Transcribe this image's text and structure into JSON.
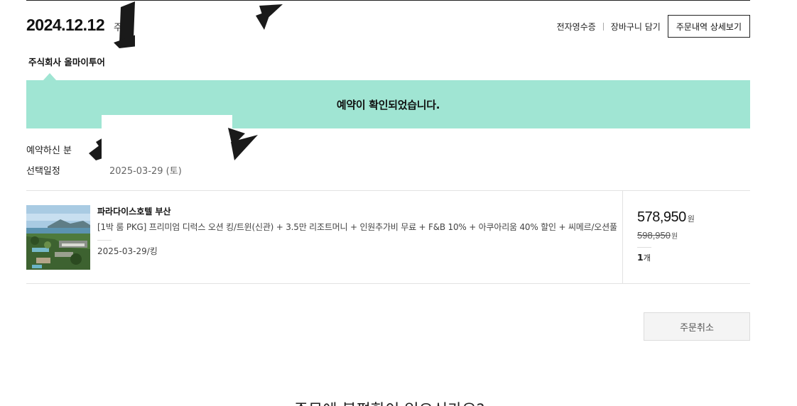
{
  "order": {
    "date": "2024.12.12",
    "number_label": "주"
  },
  "header_actions": {
    "receipt": "전자영수증",
    "cart": "장바구니 담기",
    "detail": "주문내역 상세보기"
  },
  "seller": "주식회사 올마이투어",
  "banner": {
    "message": "예약이 확인되었습니다.",
    "color": "#a0e5d3"
  },
  "reservation": {
    "name_label": "예약하신 분",
    "name_value": "",
    "date_label": "선택일정",
    "date_value": "2025-03-29 (토)"
  },
  "product": {
    "image_icon": "hotel-photo",
    "name": "파라다이스호텔 부산",
    "option": "[1박 룸 PKG] 프리미엄 디럭스 오션 킹/트윈(신관) + 3.5만 리조트머니 + 인원추가비 무료 + F&B 10% + 아쿠아리움 40% 할인 + 씨메르/오션풀",
    "selection": "2025-03-29/킹",
    "price": "578,950",
    "price_unit": "원",
    "original_price": "598,950",
    "original_price_unit": "원",
    "quantity": "1",
    "quantity_unit": "개"
  },
  "cancel_button": "주문취소",
  "bottom_heading": "주문에 불편함이 있으신가요?"
}
